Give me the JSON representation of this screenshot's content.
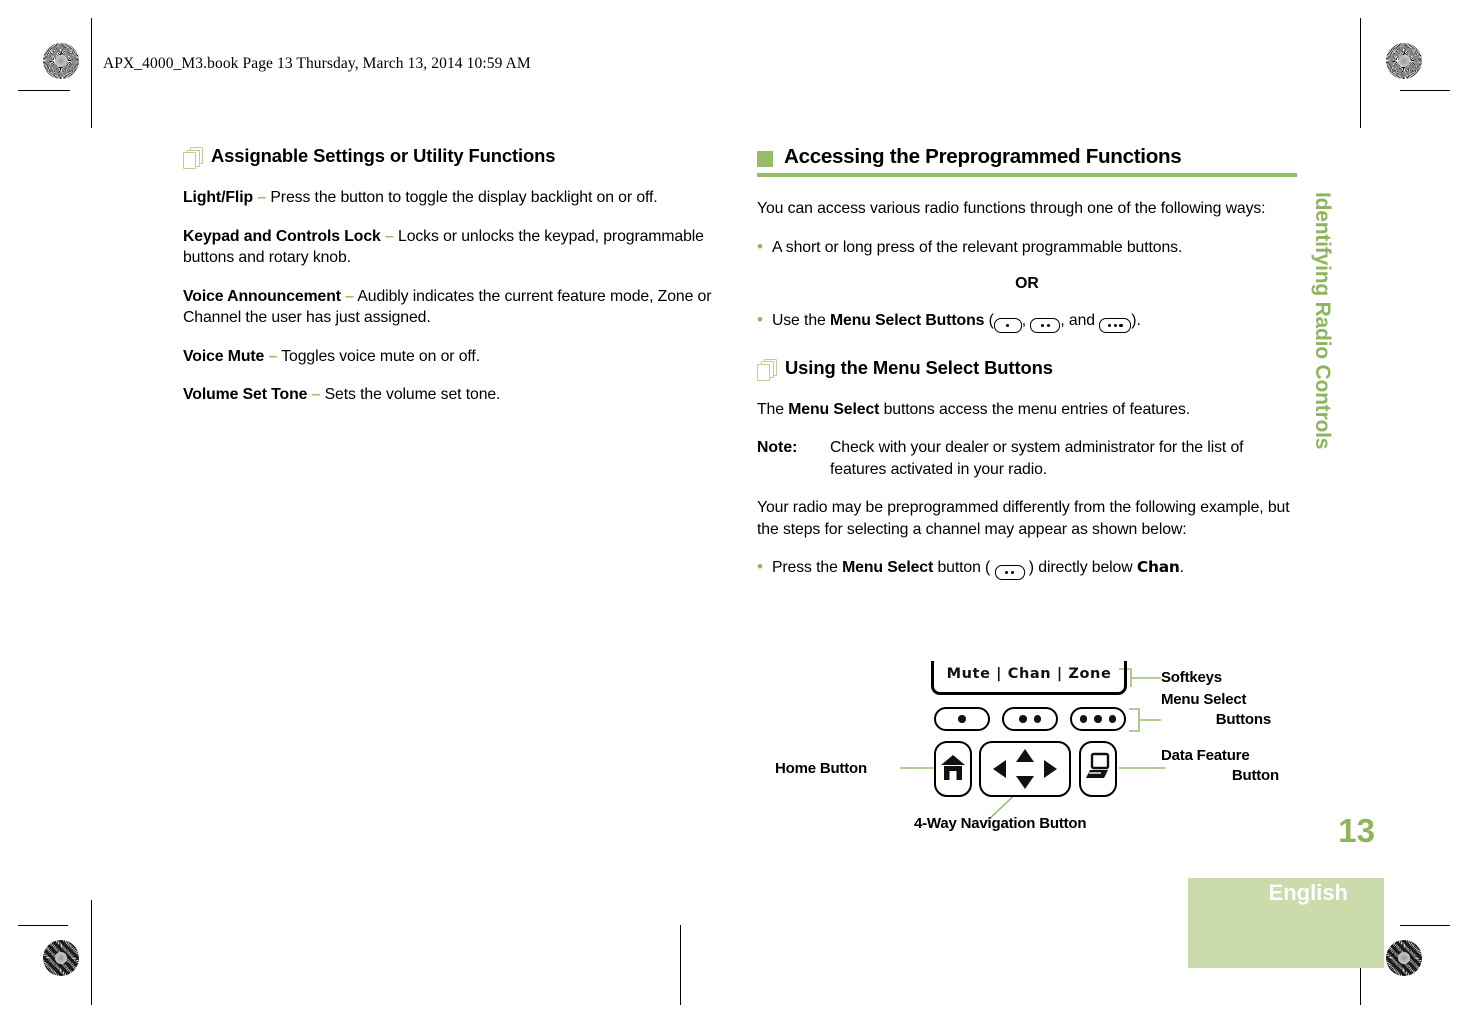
{
  "header": {
    "book_line": "APX_4000_M3.book  Page 13  Thursday, March 13, 2014  10:59 AM"
  },
  "colors": {
    "accent_green": "#96bd66",
    "pale_green": "#ccdbab",
    "heading_green": "#8eb45c",
    "leader_green": "#9cbf6e"
  },
  "left_column": {
    "heading": "Assignable Settings or Utility Functions",
    "heading_icon": "pages-stack-icon",
    "entries": [
      {
        "term": "Light/Flip",
        "dash": "–",
        "desc": "Press the button to toggle the display backlight on or off."
      },
      {
        "term": "Keypad and Controls Lock",
        "dash": "–",
        "desc": "Locks or unlocks the keypad, programmable buttons and rotary knob."
      },
      {
        "term": "Voice Announcement",
        "dash": "–",
        "desc": "Audibly indicates the current feature mode, Zone or Channel the user has just assigned."
      },
      {
        "term": "Voice Mute",
        "dash": "–",
        "desc": "Toggles voice mute on or off."
      },
      {
        "term": "Volume Set Tone",
        "dash": "–",
        "desc": "Sets the volume set tone."
      }
    ]
  },
  "right_column": {
    "main_heading": "Accessing the Preprogrammed Functions",
    "intro": "You can access various radio functions through one of the following ways:",
    "bullet_1": "A short or long press of the relevant programmable buttons.",
    "or_label": "OR",
    "bullet_2_prefix": "Use the ",
    "bullet_2_bold": "Menu Select Buttons",
    "bullet_2_mid1": " (",
    "bullet_2_mid2": ", ",
    "bullet_2_mid3": ", and ",
    "bullet_2_suffix": ").",
    "sub_heading": "Using the Menu Select Buttons",
    "sub_heading_icon": "pages-stack-icon",
    "para_1_prefix": "The ",
    "para_1_bold": "Menu Select",
    "para_1_suffix": " buttons access the menu entries of features.",
    "note_label": "Note:",
    "note_text": "Check with your dealer or system administrator for the list of features activated in your radio.",
    "para_2": "Your radio may be preprogrammed differently from the following example, but the steps for selecting a channel may appear as shown below:",
    "bullet_3_prefix": "Press the ",
    "bullet_3_bold": "Menu Select",
    "bullet_3_mid": " button ( ",
    "bullet_3_mid2": " ) directly below ",
    "bullet_3_chan": "Chan",
    "bullet_3_suffix": "."
  },
  "diagram": {
    "softkeys": [
      "Mute",
      "Chan",
      "Zone"
    ],
    "softkeys_separator": "|",
    "softkey_text": "Mute  |  Chan  |  Zone",
    "labels": {
      "softkeys": "Softkeys",
      "menu_select_line1": "Menu Select",
      "menu_select_line2": "Buttons",
      "data_feature_line1": "Data Feature",
      "data_feature_line2": "Button",
      "home": "Home Button",
      "navigation": "4-Way Navigation Button"
    },
    "menu_select_dots": [
      1,
      2,
      3
    ],
    "icons": {
      "home": "home-icon",
      "data": "laptop-icon",
      "nav_up": "triangle-up-icon",
      "nav_down": "triangle-down-icon",
      "nav_left": "triangle-left-icon",
      "nav_right": "triangle-right-icon"
    }
  },
  "sidebar": {
    "chapter_title": "Identifying Radio Controls",
    "page_number": "13",
    "language": "English"
  }
}
